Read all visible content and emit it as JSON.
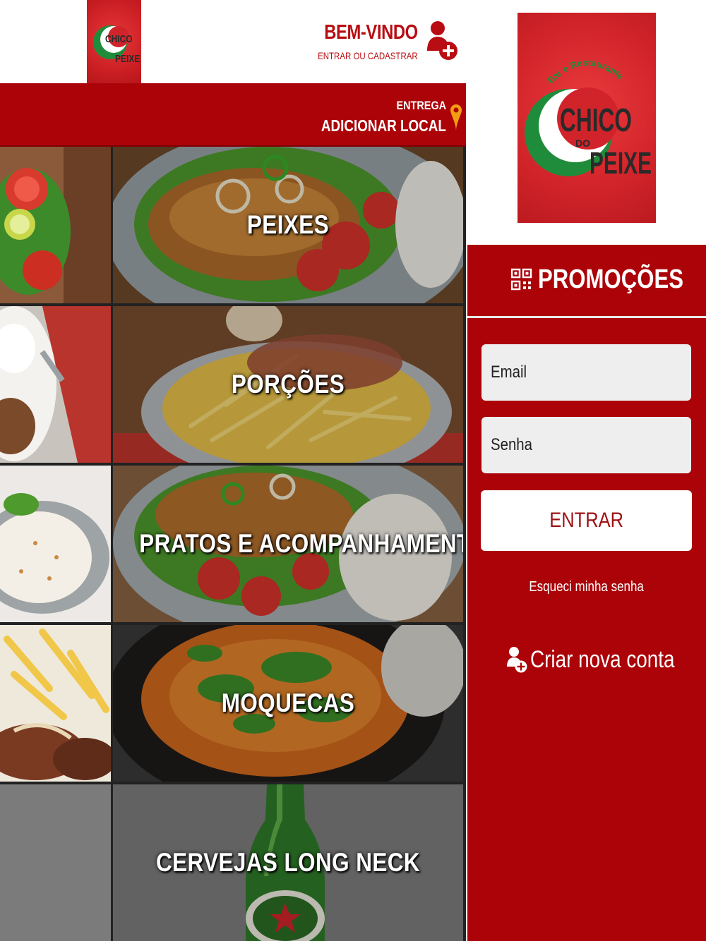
{
  "header": {
    "logo_alt": "Chico do Peixe",
    "welcome_title": "BEM-VINDO",
    "welcome_subtitle": "ENTRAR OU CADASTRAR",
    "account_icon": "add-user-icon"
  },
  "delivery": {
    "label": "ENTREGA",
    "location_action": "ADICIONAR LOCAL",
    "icon": "map-pin-icon"
  },
  "categories": [
    {
      "label": "PEIXES"
    },
    {
      "label": "PORÇÕES"
    },
    {
      "label": "PRATOS E ACOMPANHAMENTO"
    },
    {
      "label": "MOQUECAS"
    },
    {
      "label": "CERVEJAS LONG NECK"
    }
  ],
  "logo": {
    "tagline": "Bar e Restaurante",
    "name_line1": "CHICO",
    "name_line2": "DO",
    "name_line3": "PEIXE"
  },
  "login": {
    "promo_label": "PROMOÇÕES",
    "promo_icon": "qr-code-icon",
    "email_placeholder": "Email",
    "password_placeholder": "Senha",
    "submit_label": "ENTRAR",
    "forgot_label": "Esqueci minha senha",
    "create_account_label": "Criar nova conta",
    "create_account_icon": "add-user-icon"
  },
  "colors": {
    "brand_red": "#ab0308",
    "text_red": "#b80d12",
    "orange_pin": "#f39c12",
    "logo_green": "#1f8c3b"
  }
}
